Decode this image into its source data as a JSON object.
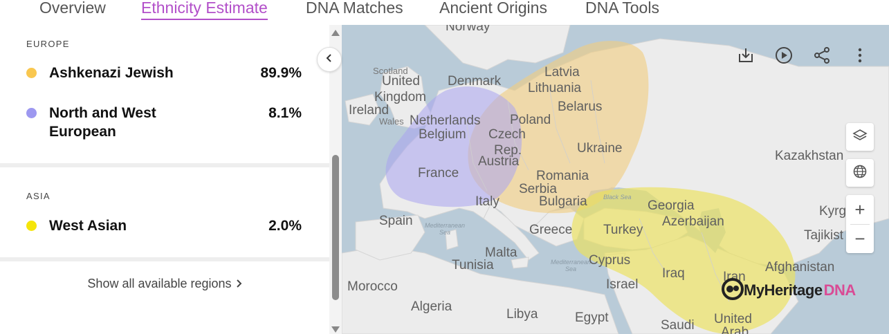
{
  "tabs": [
    {
      "label": "Overview"
    },
    {
      "label": "Ethnicity Estimate",
      "active": true
    },
    {
      "label": "DNA Matches"
    },
    {
      "label": "Ancient Origins"
    },
    {
      "label": "DNA Tools"
    }
  ],
  "groups": [
    {
      "label": "EUROPE",
      "rows": [
        {
          "name": "Ashkenazi Jewish",
          "percent": "89.9%",
          "color": "#f9c74f"
        },
        {
          "name_line1": "North and West",
          "name_line2": "European",
          "percent": "8.1%",
          "color": "#9d98f0"
        }
      ]
    },
    {
      "label": "ASIA",
      "rows": [
        {
          "name": "West Asian",
          "percent": "2.0%",
          "color": "#f5e50a"
        }
      ]
    }
  ],
  "show_all": {
    "label": "Show all available regions",
    "chevron": "chevron-right-icon"
  },
  "map": {
    "overlay_colors": {
      "ashkenazi": "#f2cd7e",
      "north_west_europe": "#a9a4f0",
      "west_asian": "#ece25a"
    },
    "places": {
      "norway": "Norway",
      "scotland": "Scotland",
      "united_kingdom_1": "United",
      "united_kingdom_2": "Kingdom",
      "ireland": "Ireland",
      "wales": "Wales",
      "denmark": "Denmark",
      "latvia": "Latvia",
      "lithuania": "Lithuania",
      "belarus": "Belarus",
      "netherlands": "Netherlands",
      "belgium": "Belgium",
      "poland": "Poland",
      "czech_1": "Czech",
      "czech_2": "Rep.",
      "austria": "Austria",
      "ukraine": "Ukraine",
      "kazakhstan": "Kazakhstan",
      "france": "France",
      "romania": "Romania",
      "serbia": "Serbia",
      "bulgaria": "Bulgaria",
      "italy": "Italy",
      "black_sea": "Black Sea",
      "georgia": "Georgia",
      "azerbaijan": "Azerbaijan",
      "kyrgyzstan": "Kyrg",
      "spain": "Spain",
      "mediterranean_1": "Mediterranean",
      "mediterranean_2": "Sea",
      "greece": "Greece",
      "turkey": "Turkey",
      "tajikistan": "Tajikist",
      "malta": "Malta",
      "tunisia": "Tunisia",
      "mediterranean_3": "Mediterranean",
      "mediterranean_4": "Sea",
      "cyprus": "Cyprus",
      "iraq": "Iraq",
      "iran": "Iran",
      "afghanistan": "Afghanistan",
      "morocco": "Morocco",
      "israel": "Israel",
      "algeria": "Algeria",
      "libya": "Libya",
      "egypt": "Egypt",
      "saudi": "Saudi",
      "uae_1": "United",
      "uae_2": "Arab"
    },
    "toolbar_icons": [
      "download-icon",
      "play-icon",
      "share-icon",
      "more-vert-icon"
    ],
    "side_controls": [
      "layers-icon",
      "globe-icon"
    ],
    "zoom": {
      "in": "+",
      "out": "−"
    },
    "logo": {
      "brand": "MyHeritage",
      "suffix": "DNA"
    }
  }
}
